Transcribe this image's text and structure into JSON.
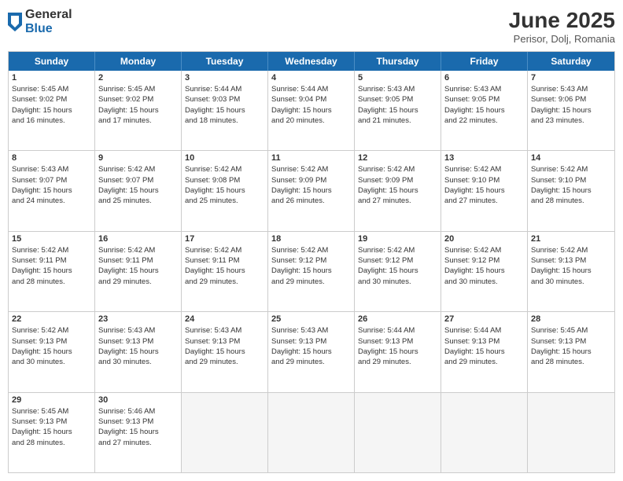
{
  "logo": {
    "general": "General",
    "blue": "Blue"
  },
  "title": "June 2025",
  "location": "Perisor, Dolj, Romania",
  "weekdays": [
    "Sunday",
    "Monday",
    "Tuesday",
    "Wednesday",
    "Thursday",
    "Friday",
    "Saturday"
  ],
  "rows": [
    [
      {
        "day": "1",
        "lines": [
          "Sunrise: 5:45 AM",
          "Sunset: 9:02 PM",
          "Daylight: 15 hours",
          "and 16 minutes."
        ]
      },
      {
        "day": "2",
        "lines": [
          "Sunrise: 5:45 AM",
          "Sunset: 9:02 PM",
          "Daylight: 15 hours",
          "and 17 minutes."
        ]
      },
      {
        "day": "3",
        "lines": [
          "Sunrise: 5:44 AM",
          "Sunset: 9:03 PM",
          "Daylight: 15 hours",
          "and 18 minutes."
        ]
      },
      {
        "day": "4",
        "lines": [
          "Sunrise: 5:44 AM",
          "Sunset: 9:04 PM",
          "Daylight: 15 hours",
          "and 20 minutes."
        ]
      },
      {
        "day": "5",
        "lines": [
          "Sunrise: 5:43 AM",
          "Sunset: 9:05 PM",
          "Daylight: 15 hours",
          "and 21 minutes."
        ]
      },
      {
        "day": "6",
        "lines": [
          "Sunrise: 5:43 AM",
          "Sunset: 9:05 PM",
          "Daylight: 15 hours",
          "and 22 minutes."
        ]
      },
      {
        "day": "7",
        "lines": [
          "Sunrise: 5:43 AM",
          "Sunset: 9:06 PM",
          "Daylight: 15 hours",
          "and 23 minutes."
        ]
      }
    ],
    [
      {
        "day": "8",
        "lines": [
          "Sunrise: 5:43 AM",
          "Sunset: 9:07 PM",
          "Daylight: 15 hours",
          "and 24 minutes."
        ]
      },
      {
        "day": "9",
        "lines": [
          "Sunrise: 5:42 AM",
          "Sunset: 9:07 PM",
          "Daylight: 15 hours",
          "and 25 minutes."
        ]
      },
      {
        "day": "10",
        "lines": [
          "Sunrise: 5:42 AM",
          "Sunset: 9:08 PM",
          "Daylight: 15 hours",
          "and 25 minutes."
        ]
      },
      {
        "day": "11",
        "lines": [
          "Sunrise: 5:42 AM",
          "Sunset: 9:09 PM",
          "Daylight: 15 hours",
          "and 26 minutes."
        ]
      },
      {
        "day": "12",
        "lines": [
          "Sunrise: 5:42 AM",
          "Sunset: 9:09 PM",
          "Daylight: 15 hours",
          "and 27 minutes."
        ]
      },
      {
        "day": "13",
        "lines": [
          "Sunrise: 5:42 AM",
          "Sunset: 9:10 PM",
          "Daylight: 15 hours",
          "and 27 minutes."
        ]
      },
      {
        "day": "14",
        "lines": [
          "Sunrise: 5:42 AM",
          "Sunset: 9:10 PM",
          "Daylight: 15 hours",
          "and 28 minutes."
        ]
      }
    ],
    [
      {
        "day": "15",
        "lines": [
          "Sunrise: 5:42 AM",
          "Sunset: 9:11 PM",
          "Daylight: 15 hours",
          "and 28 minutes."
        ]
      },
      {
        "day": "16",
        "lines": [
          "Sunrise: 5:42 AM",
          "Sunset: 9:11 PM",
          "Daylight: 15 hours",
          "and 29 minutes."
        ]
      },
      {
        "day": "17",
        "lines": [
          "Sunrise: 5:42 AM",
          "Sunset: 9:11 PM",
          "Daylight: 15 hours",
          "and 29 minutes."
        ]
      },
      {
        "day": "18",
        "lines": [
          "Sunrise: 5:42 AM",
          "Sunset: 9:12 PM",
          "Daylight: 15 hours",
          "and 29 minutes."
        ]
      },
      {
        "day": "19",
        "lines": [
          "Sunrise: 5:42 AM",
          "Sunset: 9:12 PM",
          "Daylight: 15 hours",
          "and 30 minutes."
        ]
      },
      {
        "day": "20",
        "lines": [
          "Sunrise: 5:42 AM",
          "Sunset: 9:12 PM",
          "Daylight: 15 hours",
          "and 30 minutes."
        ]
      },
      {
        "day": "21",
        "lines": [
          "Sunrise: 5:42 AM",
          "Sunset: 9:13 PM",
          "Daylight: 15 hours",
          "and 30 minutes."
        ]
      }
    ],
    [
      {
        "day": "22",
        "lines": [
          "Sunrise: 5:42 AM",
          "Sunset: 9:13 PM",
          "Daylight: 15 hours",
          "and 30 minutes."
        ]
      },
      {
        "day": "23",
        "lines": [
          "Sunrise: 5:43 AM",
          "Sunset: 9:13 PM",
          "Daylight: 15 hours",
          "and 30 minutes."
        ]
      },
      {
        "day": "24",
        "lines": [
          "Sunrise: 5:43 AM",
          "Sunset: 9:13 PM",
          "Daylight: 15 hours",
          "and 29 minutes."
        ]
      },
      {
        "day": "25",
        "lines": [
          "Sunrise: 5:43 AM",
          "Sunset: 9:13 PM",
          "Daylight: 15 hours",
          "and 29 minutes."
        ]
      },
      {
        "day": "26",
        "lines": [
          "Sunrise: 5:44 AM",
          "Sunset: 9:13 PM",
          "Daylight: 15 hours",
          "and 29 minutes."
        ]
      },
      {
        "day": "27",
        "lines": [
          "Sunrise: 5:44 AM",
          "Sunset: 9:13 PM",
          "Daylight: 15 hours",
          "and 29 minutes."
        ]
      },
      {
        "day": "28",
        "lines": [
          "Sunrise: 5:45 AM",
          "Sunset: 9:13 PM",
          "Daylight: 15 hours",
          "and 28 minutes."
        ]
      }
    ],
    [
      {
        "day": "29",
        "lines": [
          "Sunrise: 5:45 AM",
          "Sunset: 9:13 PM",
          "Daylight: 15 hours",
          "and 28 minutes."
        ]
      },
      {
        "day": "30",
        "lines": [
          "Sunrise: 5:46 AM",
          "Sunset: 9:13 PM",
          "Daylight: 15 hours",
          "and 27 minutes."
        ]
      },
      {
        "day": "",
        "lines": []
      },
      {
        "day": "",
        "lines": []
      },
      {
        "day": "",
        "lines": []
      },
      {
        "day": "",
        "lines": []
      },
      {
        "day": "",
        "lines": []
      }
    ]
  ]
}
